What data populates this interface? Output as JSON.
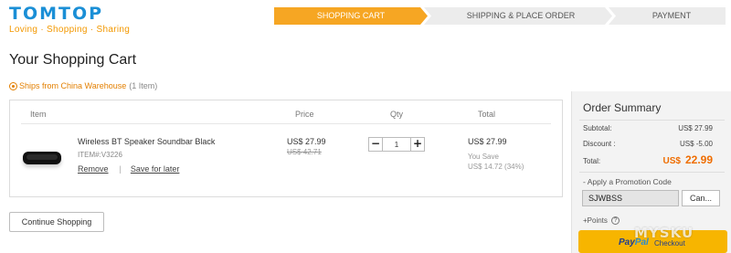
{
  "brand": {
    "name": "TOMTOP",
    "tagline": "Loving · Shopping · Sharing"
  },
  "steps": [
    "SHOPPING CART",
    "SHIPPING & PLACE ORDER",
    "PAYMENT"
  ],
  "page_title": "Your Shopping Cart",
  "ships_from": {
    "label": "Ships from China Warehouse",
    "count": "(1 Item)"
  },
  "cart": {
    "columns": {
      "item": "Item",
      "price": "Price",
      "qty": "Qty",
      "total": "Total"
    },
    "item": {
      "name": "Wireless BT Speaker Soundbar Black",
      "sku": "ITEM#:V3226",
      "remove": "Remove",
      "separator": "|",
      "save_later": "Save for later",
      "price": "US$ 27.99",
      "price_old": "US$ 42.71",
      "qty": "1",
      "total": "US$ 27.99",
      "you_save": "You Save",
      "save_amount": "US$ 14.72 (34%)"
    }
  },
  "continue_label": "Continue Shopping",
  "summary": {
    "title": "Order Summary",
    "subtotal_label": "Subtotal:",
    "subtotal_value": "US$ 27.99",
    "discount_label": "Discount :",
    "discount_value": "US$  -5.00",
    "total_label": "Total:",
    "total_currency": "US$",
    "total_value": "22.99",
    "promo_label": "- Apply a Promotion Code",
    "promo_code": "SJWBSS",
    "promo_button": "Can...",
    "points_label": "+Points",
    "paypal_pay": "Pay",
    "paypal_pal": "Pal",
    "paypal_checkout": "Checkout"
  },
  "watermark": "MYSKU",
  "colors": {
    "accent": "#f6a623",
    "brand_blue": "#1b8fd6",
    "total_orange": "#ef6d00",
    "paypal_yellow": "#f7b500"
  },
  "icons": {
    "qty_minus": "−",
    "qty_plus": "+",
    "help": "?"
  }
}
